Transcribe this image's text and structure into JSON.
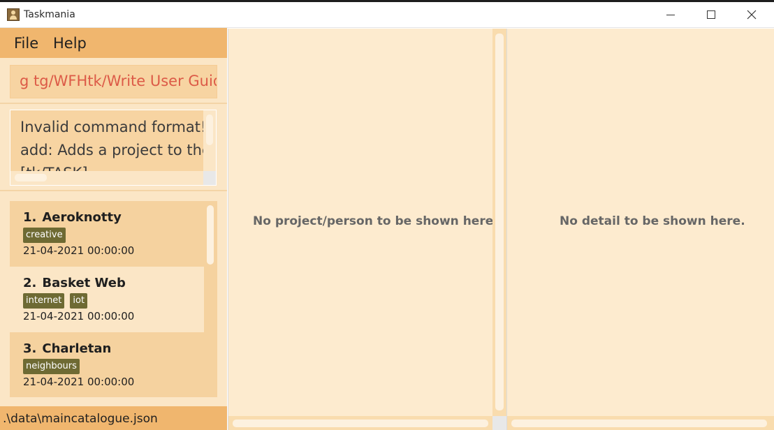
{
  "window": {
    "title": "Taskmania",
    "controls": {
      "minimize": "minimize",
      "maximize": "maximize",
      "close": "close"
    }
  },
  "menu": {
    "items": [
      "File",
      "Help"
    ]
  },
  "command": {
    "value": "g tg/WFHtk/Write User Guide"
  },
  "result": {
    "lines": [
      "Invalid command format!",
      "add: Adds a project to the m",
      "[tk/TASK]..."
    ]
  },
  "projects": [
    {
      "index": "1.",
      "name": "Aeroknotty",
      "tags": [
        "creative"
      ],
      "date": "21-04-2021 00:00:00"
    },
    {
      "index": "2.",
      "name": "Basket Web",
      "tags": [
        "internet",
        "iot"
      ],
      "date": "21-04-2021 00:00:00"
    },
    {
      "index": "3.",
      "name": "Charletan",
      "tags": [
        "neighbours"
      ],
      "date": "21-04-2021 00:00:00"
    }
  ],
  "status": {
    "path": ".\\data\\maincatalogue.json"
  },
  "middle_panel": {
    "message": "No project/person to be shown here."
  },
  "right_panel": {
    "message": "No detail to be shown here."
  },
  "colors": {
    "menu_bar": "#f0b66e",
    "panel_bg": "#fbe6c6",
    "card_alt": "#f5d29f",
    "tag_bg": "#6e6a33",
    "command_text": "#dc5a47"
  }
}
